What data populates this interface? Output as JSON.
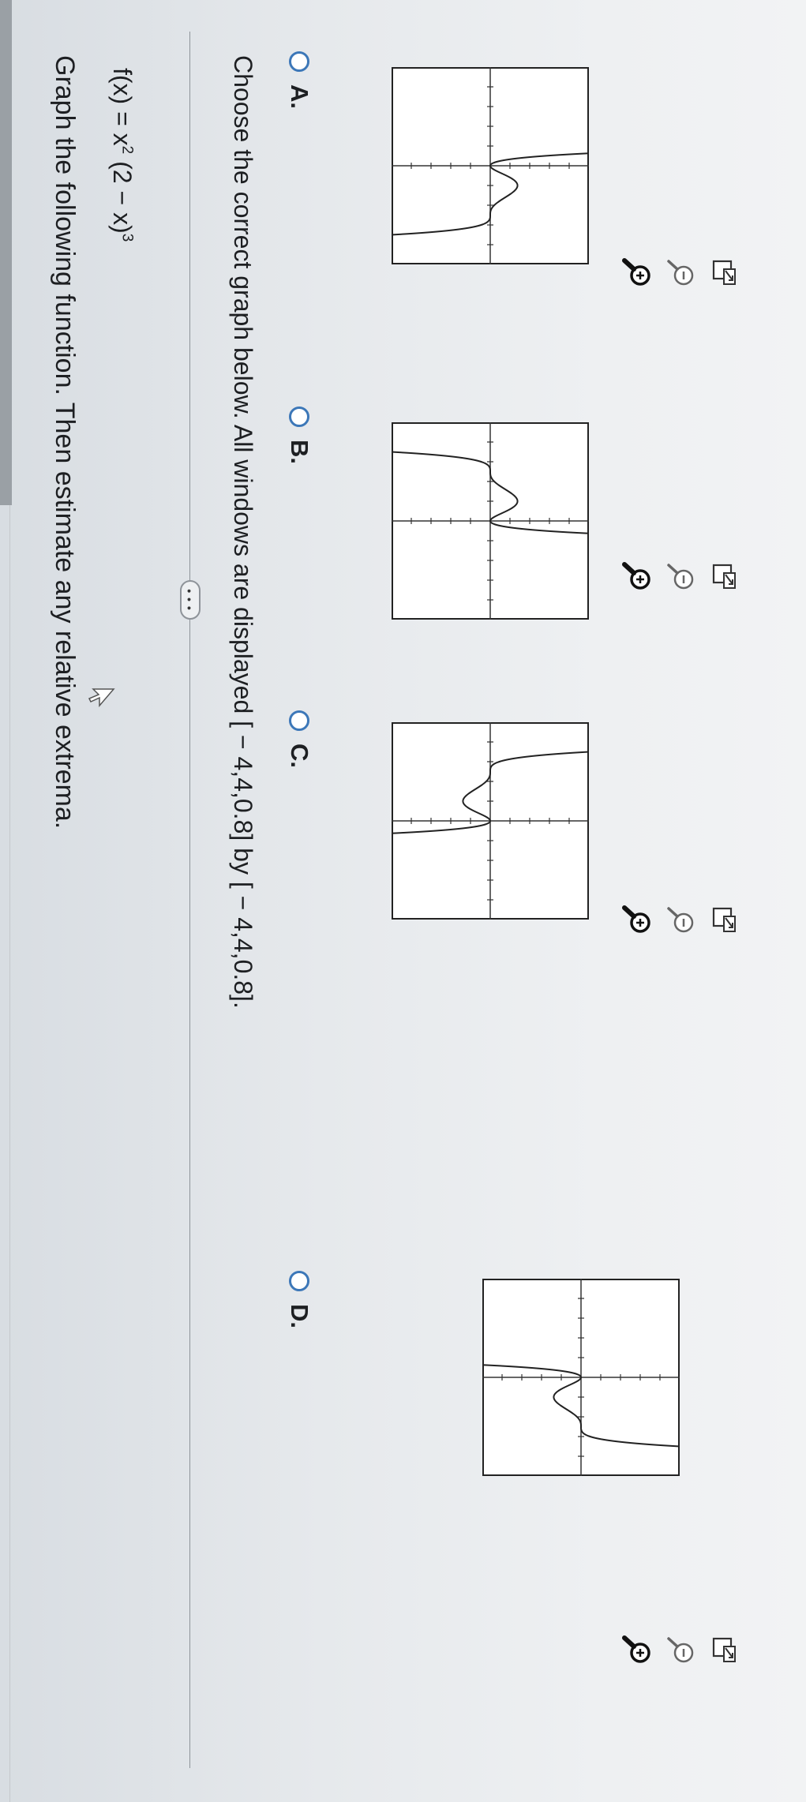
{
  "question": {
    "text": "Graph the following function. Then estimate any relative extrema.",
    "function_lhs": "f(x) = x",
    "function_exp1": "2",
    "function_mid": " (2 − x)",
    "function_exp2": "3"
  },
  "more_button": {
    "label": "• • •"
  },
  "instruction": {
    "text": "Choose the correct graph below. All windows are displayed [ − 4,4,0.8] by [ − 4,4,0.8]."
  },
  "window": {
    "xmin": -4,
    "xmax": 4,
    "xscl": 0.8,
    "ymin": -4,
    "ymax": 4,
    "yscl": 0.8
  },
  "options": [
    {
      "id": "A",
      "label": "A.",
      "selected": false
    },
    {
      "id": "B",
      "label": "B.",
      "selected": false
    },
    {
      "id": "C",
      "label": "C.",
      "selected": false
    },
    {
      "id": "D",
      "label": "D.",
      "selected": false
    }
  ],
  "option_tools": [
    "zoom-in-icon",
    "zoom-out-icon",
    "open-in-new-window-icon"
  ],
  "colors": {
    "radio": "#3c77b8",
    "curve": "#222222",
    "axis": "#333333",
    "border": "#222222"
  }
}
